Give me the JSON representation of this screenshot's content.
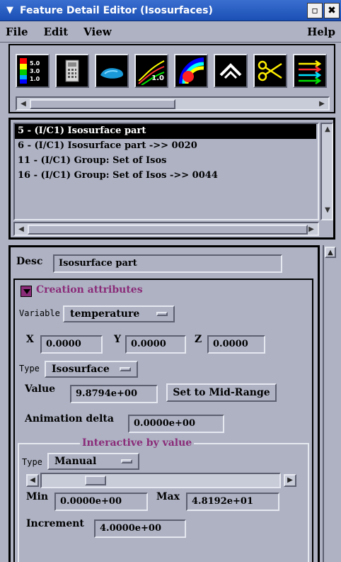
{
  "window": {
    "title": "Feature Detail Editor (Isosurfaces)",
    "minimize_glyph": "▫",
    "close_glyph": "✖"
  },
  "menubar": {
    "file": "File",
    "edit": "Edit",
    "view": "View",
    "help": "Help"
  },
  "toolbar": {
    "legend_values": [
      "5.0",
      "3.0",
      "1.0"
    ],
    "contour_value": "1.0",
    "icons": [
      "color-legend-icon",
      "calculator-icon",
      "isosurface-part-icon",
      "contour-icon",
      "isosurface-color-icon",
      "elevate-icon",
      "clip-icon",
      "particle-trace-icon"
    ]
  },
  "parts_list": {
    "items": [
      {
        "label": "5 - (I/C1) Isosurface part",
        "selected": true
      },
      {
        "label": "6 - (I/C1) Isosurface part ->> 0020",
        "selected": false
      },
      {
        "label": "11 - (I/C1) Group: Set of Isos",
        "selected": false
      },
      {
        "label": "16 - (I/C1) Group: Set of Isos ->> 0044",
        "selected": false
      }
    ]
  },
  "detail": {
    "desc_label": "Desc",
    "desc_value": "Isosurface part",
    "section_title": "Creation attributes",
    "variable_label": "Variable",
    "variable_value": "temperature",
    "x_label": "X",
    "x_value": "0.0000",
    "y_label": "Y",
    "y_value": "0.0000",
    "z_label": "Z",
    "z_value": "0.0000",
    "type_label": "Type",
    "type_value": "Isosurface",
    "value_label": "Value",
    "value_value": "9.8794e+00",
    "mid_range_button": "Set to Mid-Range",
    "anim_delta_label": "Animation delta",
    "anim_delta_value": "0.0000e+00",
    "interactive_title": "Interactive by value",
    "interactive_type_label": "Type",
    "interactive_type_value": "Manual",
    "slider_level": 0.2,
    "min_label": "Min",
    "min_value": "0.0000e+00",
    "max_label": "Max",
    "max_value": "4.8192e+01",
    "increment_label": "Increment",
    "increment_value": "4.0000e+00"
  },
  "colors": {
    "accent": "#8a2b78",
    "titlebar": "#1b4fb4",
    "panel": "#aeb2c3"
  }
}
